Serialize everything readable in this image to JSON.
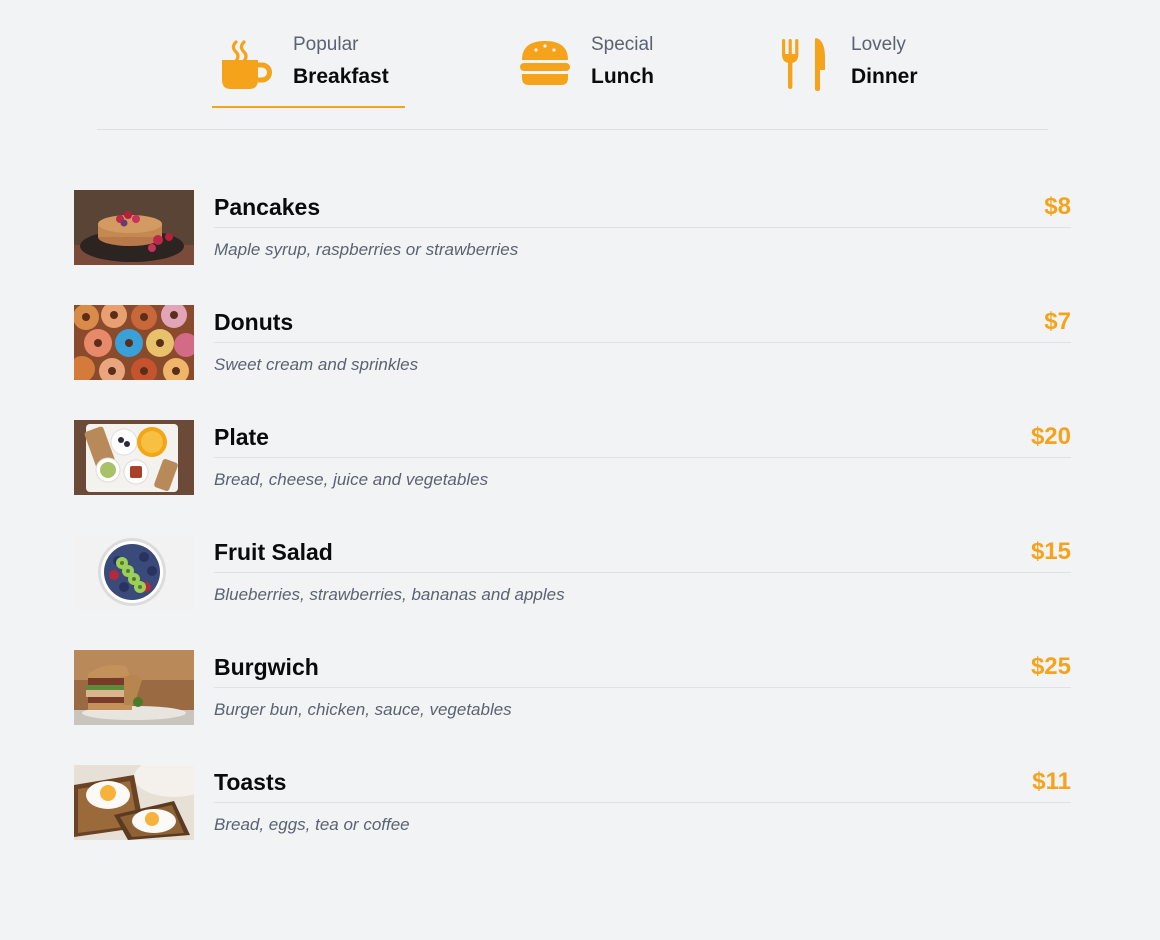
{
  "tabs": [
    {
      "subtitle": "Popular",
      "title": "Breakfast",
      "icon": "coffee-cup-icon",
      "active": true
    },
    {
      "subtitle": "Special",
      "title": "Lunch",
      "icon": "burger-icon",
      "active": false
    },
    {
      "subtitle": "Lovely",
      "title": "Dinner",
      "icon": "fork-knife-icon",
      "active": false
    }
  ],
  "colors": {
    "accent": "#f5a31b",
    "background": "#f2f3f5",
    "heading": "#0b0b0b",
    "muted": "#5b6270",
    "divider": "#dfe1e5"
  },
  "menu": {
    "items": [
      {
        "name": "Pancakes",
        "price": "$8",
        "description": "Maple syrup, raspberries or strawberries"
      },
      {
        "name": "Donuts",
        "price": "$7",
        "description": "Sweet cream and sprinkles"
      },
      {
        "name": "Plate",
        "price": "$20",
        "description": "Bread, cheese, juice and vegetables"
      },
      {
        "name": "Fruit Salad",
        "price": "$15",
        "description": "Blueberries, strawberries, bananas and apples"
      },
      {
        "name": "Burgwich",
        "price": "$25",
        "description": "Burger bun, chicken, sauce, vegetables"
      },
      {
        "name": "Toasts",
        "price": "$11",
        "description": "Bread, eggs, tea or coffee"
      }
    ]
  }
}
